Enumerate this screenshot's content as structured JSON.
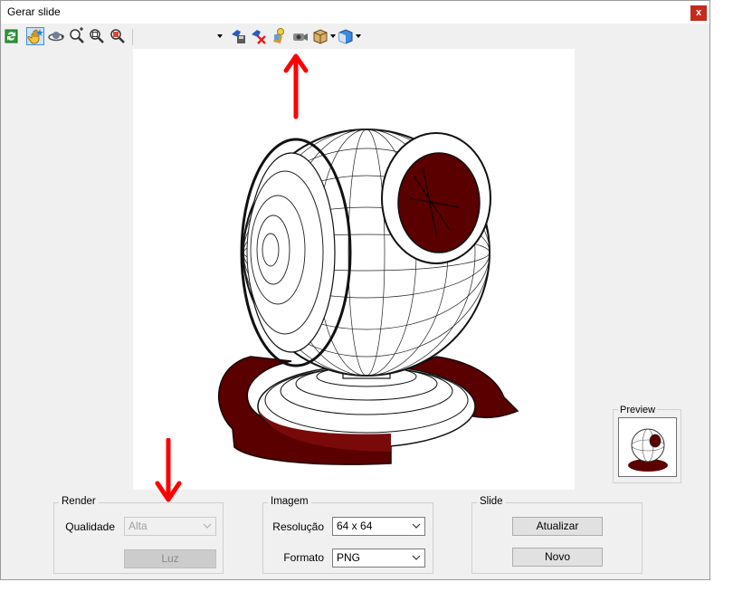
{
  "window": {
    "title": "Gerar slide",
    "close_label": "x"
  },
  "toolbar": {
    "icons": [
      "refresh-icon",
      "pan-hand-icon",
      "orbit-icon",
      "zoom-in-icon",
      "zoom-extents-icon",
      "zoom-window-icon",
      "save-view-icon",
      "delete-view-icon",
      "light-bulb-icon",
      "camera-icon",
      "box-view-icon",
      "shading-icon"
    ],
    "view_combo_value": ""
  },
  "preview": {
    "label": "Preview"
  },
  "render": {
    "group_label": "Render",
    "quality_label": "Qualidade",
    "quality_value": "Alta",
    "light_button": "Luz"
  },
  "image": {
    "group_label": "Imagem",
    "resolution_label": "Resolução",
    "resolution_value": "64 x 64",
    "format_label": "Formato",
    "format_value": "PNG"
  },
  "slide": {
    "group_label": "Slide",
    "update_button": "Atualizar",
    "new_button": "Novo"
  },
  "annotation_color": "#ff0000",
  "model_color": "#5a0000"
}
